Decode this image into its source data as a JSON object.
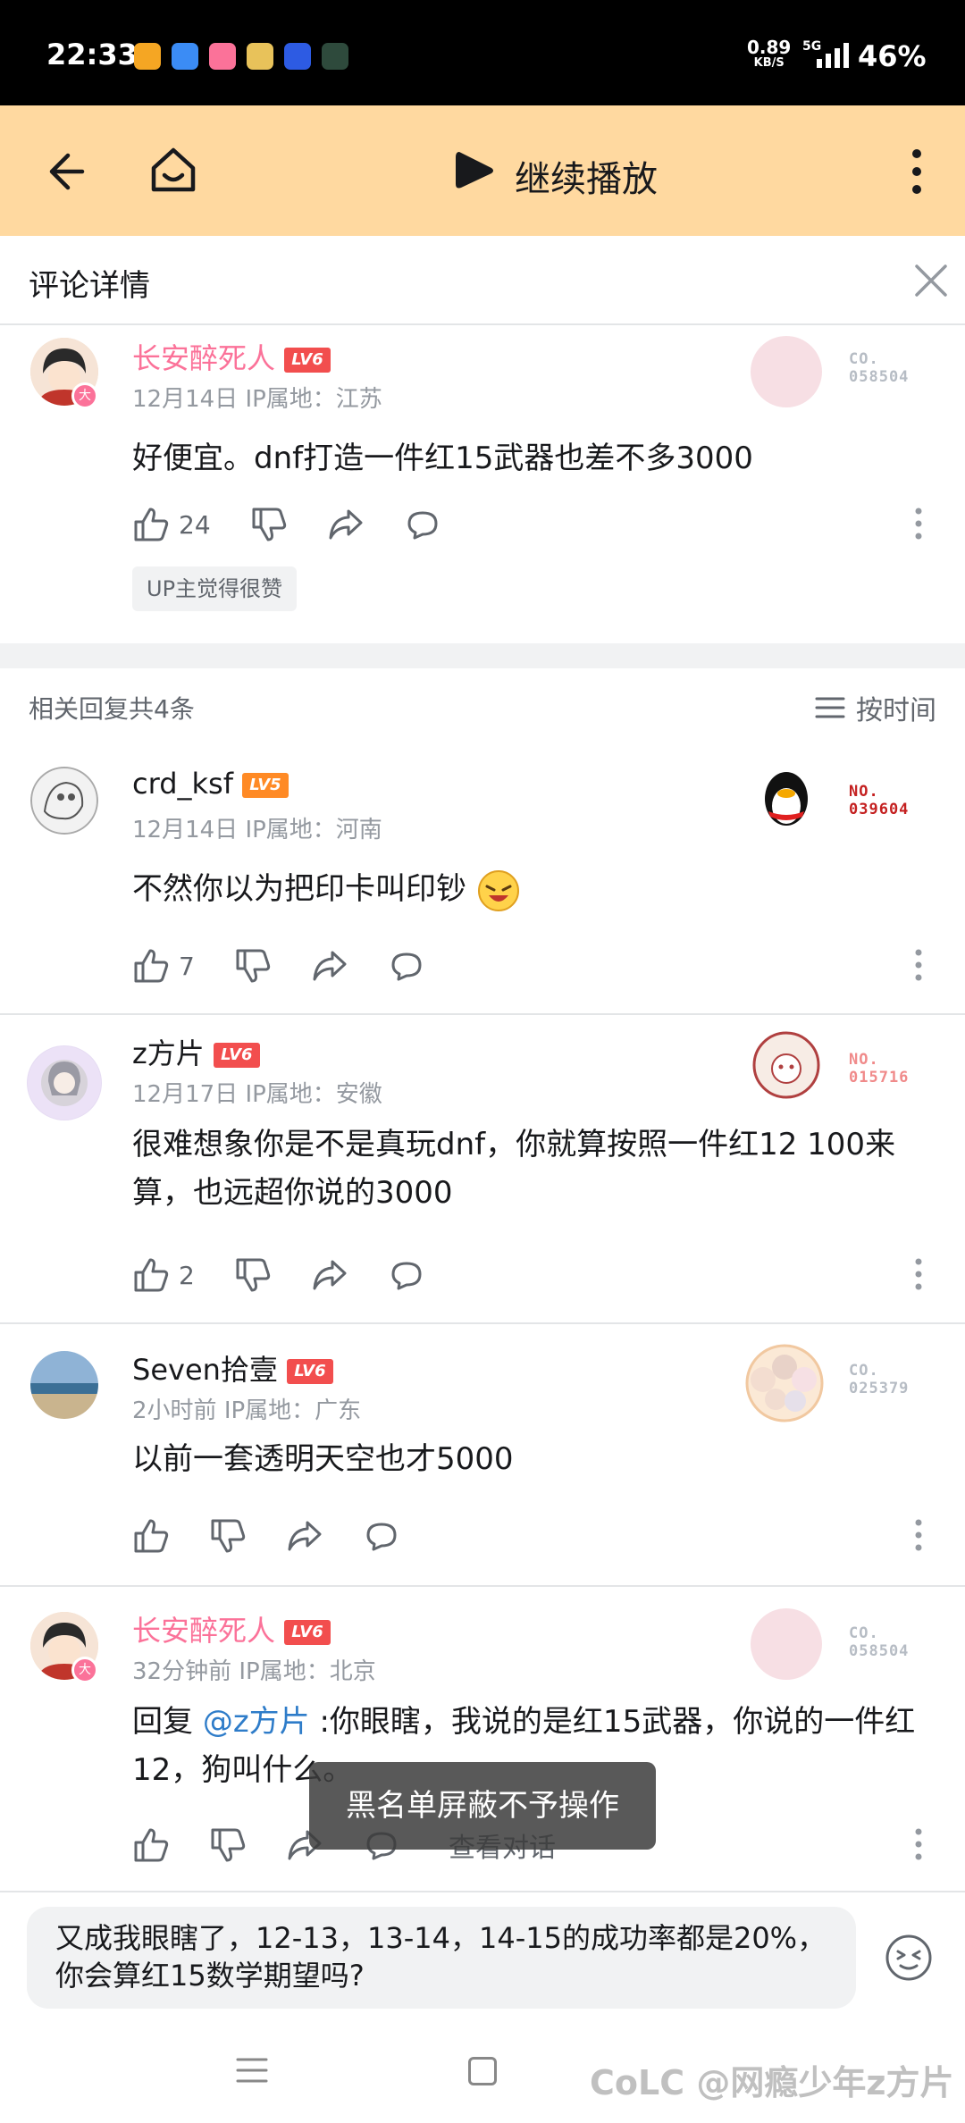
{
  "status_bar": {
    "time": "22:33",
    "speed_value": "0.89",
    "speed_unit": "KB/S",
    "network": "5G",
    "battery": "46%"
  },
  "toolbar": {
    "play_label": "继续播放"
  },
  "panel": {
    "title": "评论详情"
  },
  "main_comment": {
    "username": "长安醉死人",
    "level": "LV6",
    "avatar_badge": "大",
    "date": "12月14日",
    "ip": "IP属地：江苏",
    "text": "好便宜。dnf打造一件红15武器也差不多3000",
    "likes": "24",
    "fan_no_label": "CO.",
    "fan_no": "058504",
    "tag": "UP主觉得很赞"
  },
  "replies_header": {
    "count_text": "相关回复共4条",
    "sort_label": "按时间"
  },
  "replies": [
    {
      "username": "crd_ksf",
      "level": "LV5",
      "date": "12月14日",
      "ip": "IP属地：河南",
      "text": "不然你以为把印卡叫印钞",
      "likes": "7",
      "fan_no_label": "NO.",
      "fan_no": "039604"
    },
    {
      "username": "z方片",
      "level": "LV6",
      "date": "12月17日",
      "ip": "IP属地：安徽",
      "text": "很难想象你是不是真玩dnf，你就算按照一件红12 100来算，也远超你说的3000",
      "likes": "2",
      "fan_no_label": "NO.",
      "fan_no": "015716"
    },
    {
      "username": "Seven拾壹",
      "level": "LV6",
      "date": "2小时前",
      "ip": "IP属地：广东",
      "text": "以前一套透明天空也才5000",
      "likes": "",
      "fan_no_label": "CO.",
      "fan_no": "025379"
    },
    {
      "username": "长安醉死人",
      "level": "LV6",
      "avatar_badge": "大",
      "date": "32分钟前",
      "ip": "IP属地：北京",
      "reply_prefix": "回复 ",
      "mention": "@z方片",
      "text": " :你眼瞎，我说的是红15武器，你说的一件红12，狗叫什么。",
      "likes": "",
      "view_conversation": "查看对话",
      "fan_no_label": "CO.",
      "fan_no": "058504"
    }
  ],
  "toast": "黑名单屏蔽不予操作",
  "input": {
    "value": "又成我眼瞎了，12-13，13-14，14-15的成功率都是20%，你会算红15数学期望吗?"
  },
  "watermark": "CoLC @网瘾少年z方片",
  "colors": {
    "toolbar_bg": "#ffd9a0",
    "vip_name": "#fb7299",
    "level6": "#f24e4e",
    "level5": "#ff8a25",
    "mention": "#2e7cc9"
  }
}
